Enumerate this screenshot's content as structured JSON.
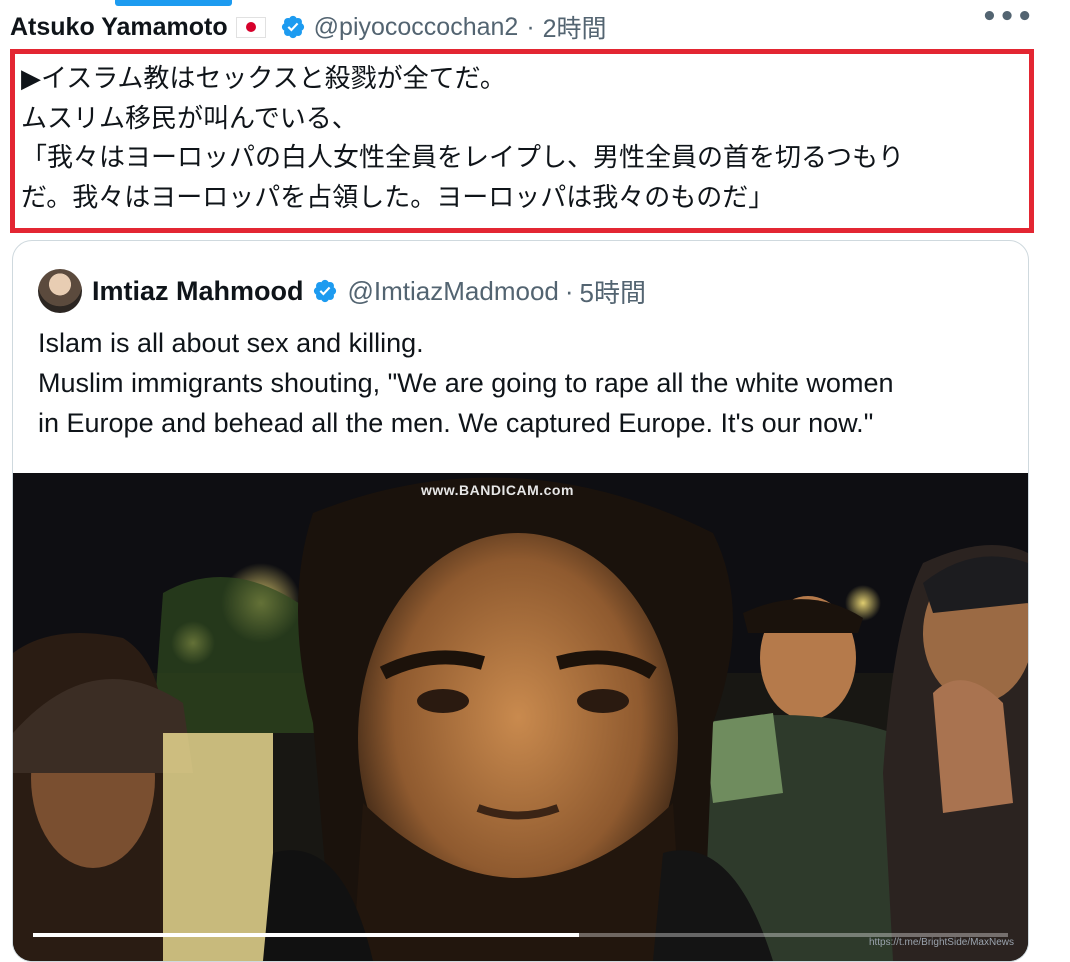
{
  "tweet": {
    "author_name": "Atsuko Yamamoto",
    "flag": "japan-flag",
    "verified_icon": "verified-badge-icon",
    "handle": "@piyococcochan2",
    "separator": "·",
    "time": "2時間",
    "more_label": "•••",
    "text_lines": [
      "▶イスラム教はセックスと殺戮が全てだ。",
      "ムスリム移民が叫んでいる、",
      "「我々はヨーロッパの白人女性全員をレイプし、男性全員の首を切るつもり",
      "だ。我々はヨーロッパを占領した。ヨーロッパは我々のものだ」"
    ],
    "highlight_color": "#e32632"
  },
  "quote": {
    "author_name": "Imtiaz Mahmood",
    "verified_icon": "verified-badge-icon",
    "handle": "@ImtiazMadmood",
    "separator": "·",
    "time": "5時間",
    "text_lines": [
      "Islam is all about sex and killing.",
      "Muslim immigrants shouting, \"We are going to rape all the white women",
      "in Europe and behead all the men. We captured Europe. It's our now.\""
    ]
  },
  "video": {
    "watermark": "www.BANDICAM.com",
    "progress": 0.56,
    "credit": "https://t.me/BrightSide/MaxNews"
  },
  "colors": {
    "accent": "#1d9bf0",
    "text": "#0f1419",
    "secondary_text": "#536471",
    "border": "#cfd9de"
  }
}
